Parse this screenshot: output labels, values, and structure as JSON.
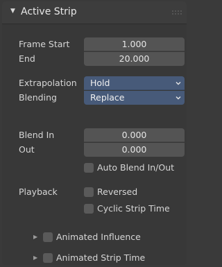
{
  "panel": {
    "title": "Active Strip",
    "frame_start": {
      "label": "Frame Start",
      "value": "1.000"
    },
    "end": {
      "label": "End",
      "value": "20.000"
    },
    "extrapolation": {
      "label": "Extrapolation",
      "value": "Hold"
    },
    "blending": {
      "label": "Blending",
      "value": "Replace"
    },
    "blend_in": {
      "label": "Blend In",
      "value": "0.000"
    },
    "blend_out": {
      "label": "Out",
      "value": "0.000"
    },
    "auto_blend": {
      "label": "Auto Blend In/Out",
      "checked": false
    },
    "playback": {
      "label": "Playback",
      "reversed": {
        "label": "Reversed",
        "checked": false
      },
      "cyclic": {
        "label": "Cyclic Strip Time",
        "checked": false
      }
    },
    "subpanels": [
      {
        "label": "Animated Influence",
        "checked": false,
        "expanded": false
      },
      {
        "label": "Animated Strip Time",
        "checked": false,
        "expanded": false
      }
    ]
  },
  "colors": {
    "panel_bg": "#383838",
    "field_bg": "#545454",
    "dropdown_bg": "#475a79"
  }
}
